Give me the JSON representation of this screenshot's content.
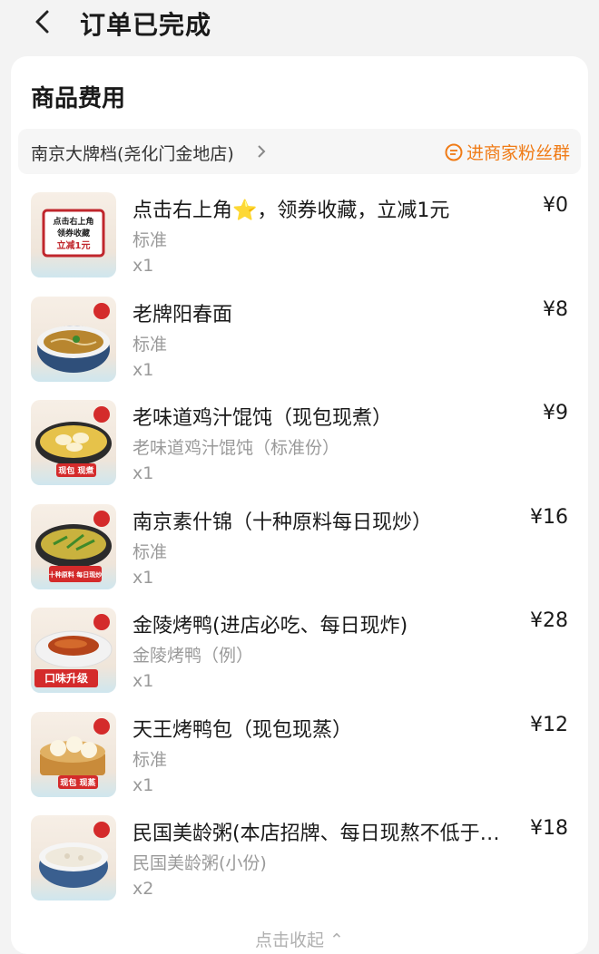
{
  "header": {
    "title": "订单已完成"
  },
  "section": {
    "title": "商品费用"
  },
  "shop": {
    "name": "南京大牌档(尧化门金地店)",
    "fans_group": "进商家粉丝群"
  },
  "colors": {
    "accent": "#f07b16",
    "muted": "#9a9a9a"
  },
  "items": [
    {
      "name": "点击右上角⭐，领券收藏，立减1元",
      "spec": "标准",
      "qty": "x1",
      "price": "¥0",
      "thumb_text": [
        "点击右上角",
        "领券收藏",
        "立减1元"
      ]
    },
    {
      "name": "老牌阳春面",
      "spec": "标准",
      "qty": "x1",
      "price": "¥8"
    },
    {
      "name": "老味道鸡汁馄饨（现包现煮）",
      "spec": "老味道鸡汁馄饨（标准份）",
      "qty": "x1",
      "price": "¥9",
      "badge": "现包 现煮"
    },
    {
      "name": "南京素什锦（十种原料每日现炒）",
      "spec": "标准",
      "qty": "x1",
      "price": "¥16",
      "badge": "十种原料 每日现炒"
    },
    {
      "name": "金陵烤鸭(进店必吃、每日现炸)",
      "spec": "金陵烤鸭（例）",
      "qty": "x1",
      "price": "¥28",
      "badge": "口味升级"
    },
    {
      "name": "天王烤鸭包（现包现蒸）",
      "spec": "标准",
      "qty": "x1",
      "price": "¥12",
      "badge": "现包 现蒸"
    },
    {
      "name": "民国美龄粥(本店招牌、每日现熬不低于…",
      "spec": "民国美龄粥(小份)",
      "qty": "x2",
      "price": "¥18"
    }
  ],
  "footer": {
    "collapse_label": "点击收起 ⌃"
  }
}
